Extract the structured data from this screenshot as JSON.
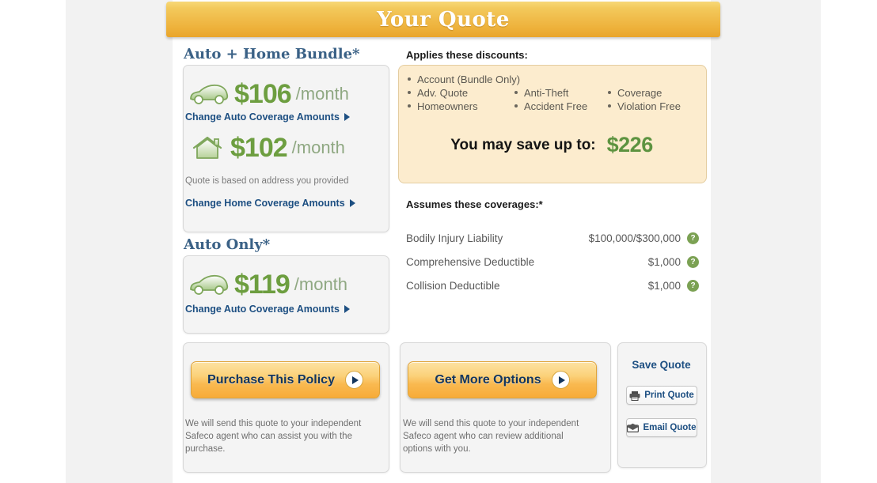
{
  "header": {
    "title": "Your Quote"
  },
  "bundle": {
    "section_title": "Auto + Home Bundle*",
    "auto": {
      "icon": "car-icon",
      "amount": "$106",
      "period": "/month",
      "change_link": "Change Auto Coverage Amounts"
    },
    "home": {
      "icon": "house-icon",
      "amount": "$102",
      "period": "/month",
      "note": "Quote is based on address you provided",
      "change_link": "Change Home Coverage Amounts"
    }
  },
  "auto_only": {
    "section_title": "Auto Only*",
    "icon": "car-icon",
    "amount": "$119",
    "period": "/month",
    "change_link": "Change Auto Coverage Amounts"
  },
  "discounts": {
    "label": "Applies these discounts:",
    "items": [
      "Account (Bundle Only)",
      "Adv. Quote",
      "Anti-Theft",
      "Coverage",
      "Homeowners",
      "Accident Free",
      "Violation Free"
    ],
    "save_label": "You may save up to:",
    "save_amount": "$226"
  },
  "coverages": {
    "label": "Assumes these coverages:*",
    "help_glyph": "?",
    "rows": [
      {
        "name": "Bodily Injury Liability",
        "value": "$100,000/$300,000"
      },
      {
        "name": "Comprehensive Deductible",
        "value": "$1,000"
      },
      {
        "name": "Collision Deductible",
        "value": "$1,000"
      }
    ]
  },
  "actions": {
    "purchase": {
      "button_label": "Purchase This Policy",
      "note": "We will send this quote to your independent Safeco agent who can assist you with the purchase."
    },
    "options": {
      "button_label": "Get More Options",
      "note": "We will send this quote to your independent Safeco agent who can review additional options with you."
    },
    "save_quote": {
      "title": "Save Quote",
      "print_label": "Print Quote",
      "print_icon": "printer-icon",
      "email_label": "Email Quote",
      "email_icon": "envelope-icon"
    }
  },
  "colors": {
    "header_gold": "#eeb23c",
    "price_green": "#6d9e40",
    "link_navy": "#1d4f82",
    "section_blue": "#3a6186",
    "discount_panel": "#fcecce",
    "help_green": "#7ba153"
  }
}
